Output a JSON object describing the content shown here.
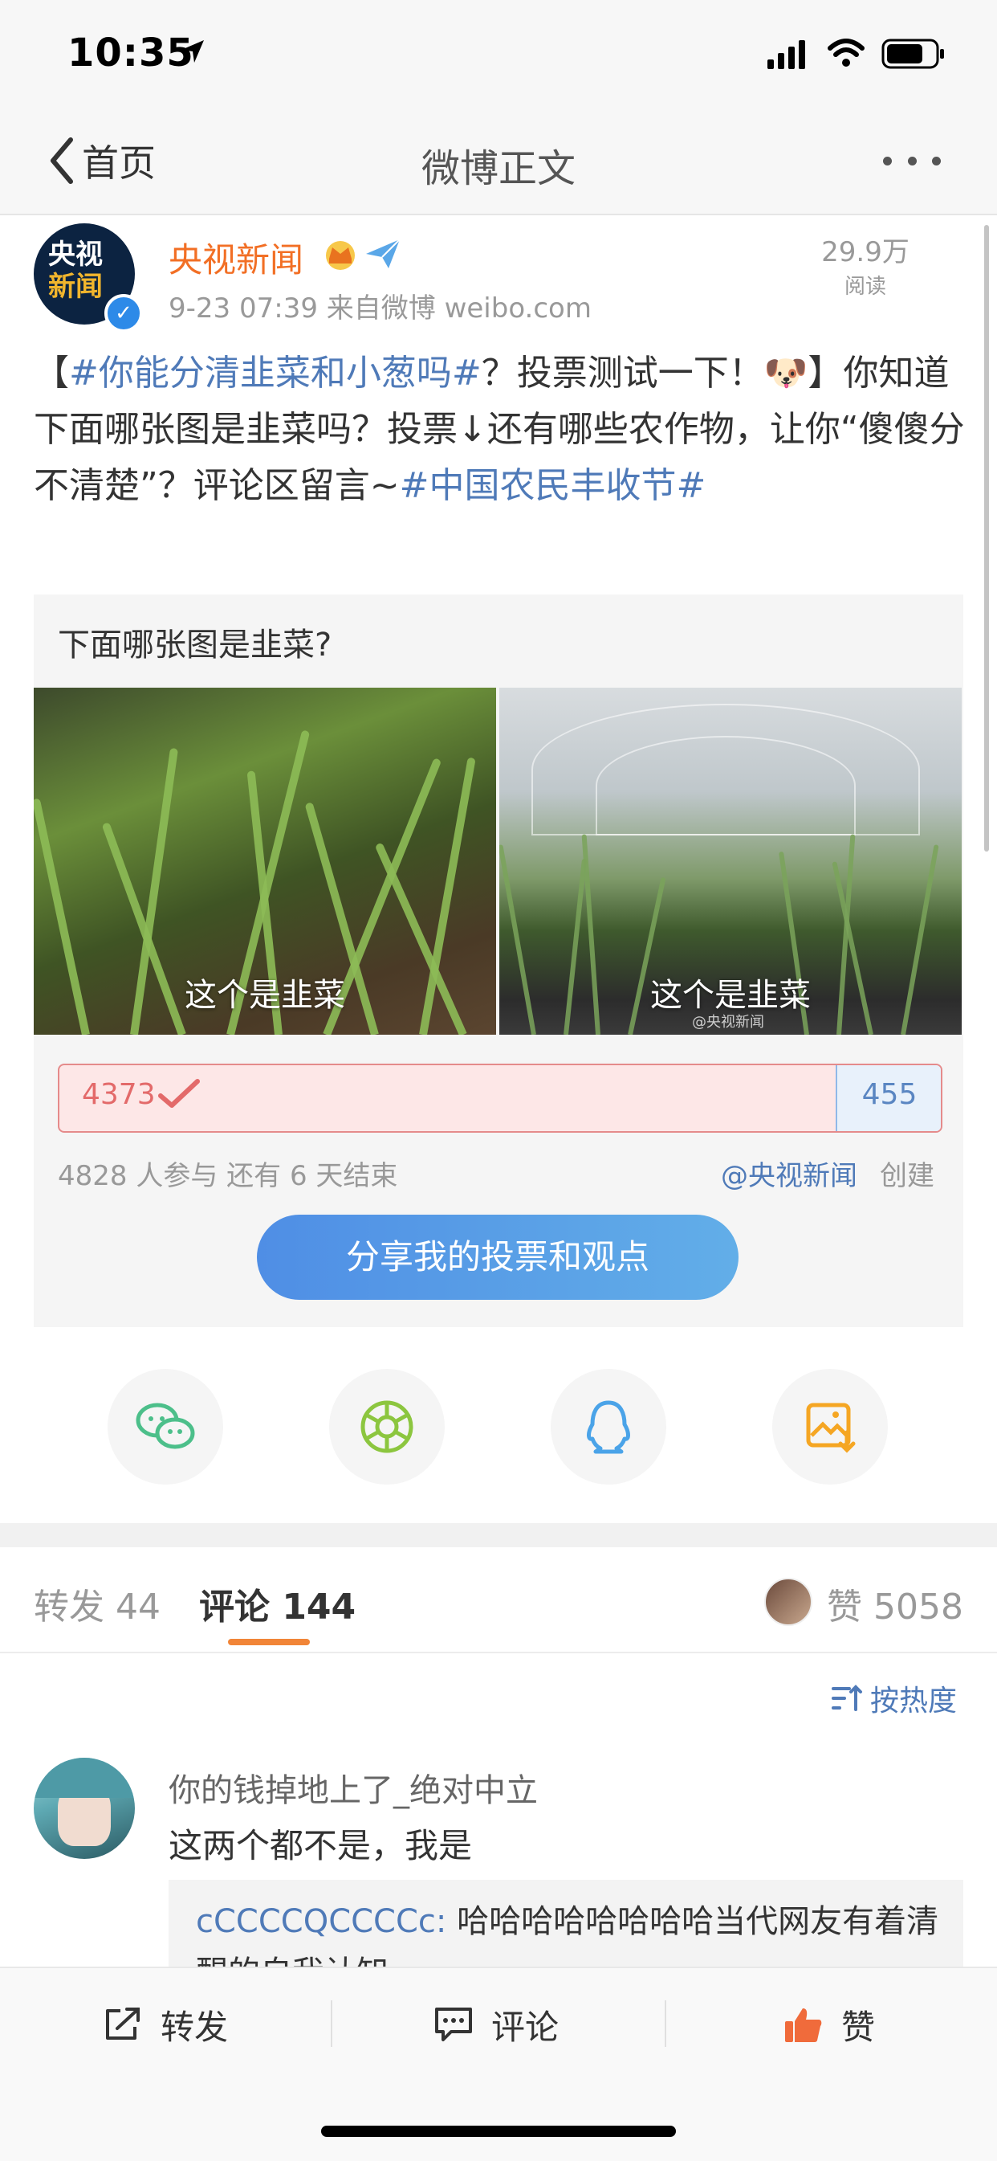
{
  "status_bar": {
    "time": "10:35"
  },
  "nav": {
    "back_label": "首页",
    "title": "微博正文"
  },
  "post": {
    "avatar_line1": "央视",
    "avatar_line2": "新闻",
    "username": "央视新闻",
    "meta": "9-23 07:39  来自微博 weibo.com",
    "read_count": "29.9万",
    "read_label": "阅读",
    "body": {
      "open_bracket": "【",
      "topic1": "#你能分清韭菜和小葱吗#",
      "text1": "？投票测试一下！",
      "emoji": "🐶",
      "text2": "】你知道下面哪张图是韭菜吗？投票↓还有哪些农作物，让你“傻傻分不清楚”？评论区留言~",
      "topic2": "#中国农民丰收节#"
    }
  },
  "poll": {
    "question": "下面哪张图是韭菜?",
    "option_left_caption": "这个是韭菜",
    "option_right_caption": "这个是韭菜",
    "watermark": "@央视新闻",
    "left_votes": "4373",
    "right_votes": "455",
    "left_fraction": 0.906,
    "stats": "4828 人参与   还有 6 天结束",
    "creator": "@央视新闻",
    "created_label": "创建",
    "share_label": "分享我的投票和观点"
  },
  "share_icons": [
    "wechat-icon",
    "moments-icon",
    "qq-icon",
    "save-image-icon"
  ],
  "tabs": {
    "repost": "转发 44",
    "comment": "评论 144",
    "likes": "赞 5058"
  },
  "sort_label": "按热度",
  "comment": {
    "user": "你的钱掉地上了_绝对中立",
    "text": "这两个都不是，我是",
    "reply_user": "cCCCCQCCCCc:",
    "reply_text": " 哈哈哈哈哈哈哈哈当代网友有着清醒的自我认知"
  },
  "bottom_bar": {
    "repost": "转发",
    "comment": "评论",
    "like": "赞"
  },
  "colors": {
    "accent_orange": "#f26f25",
    "topic_blue": "#4f7ab8",
    "poll_red": "#e36a6a",
    "share_blue": "#4f8ee5"
  }
}
